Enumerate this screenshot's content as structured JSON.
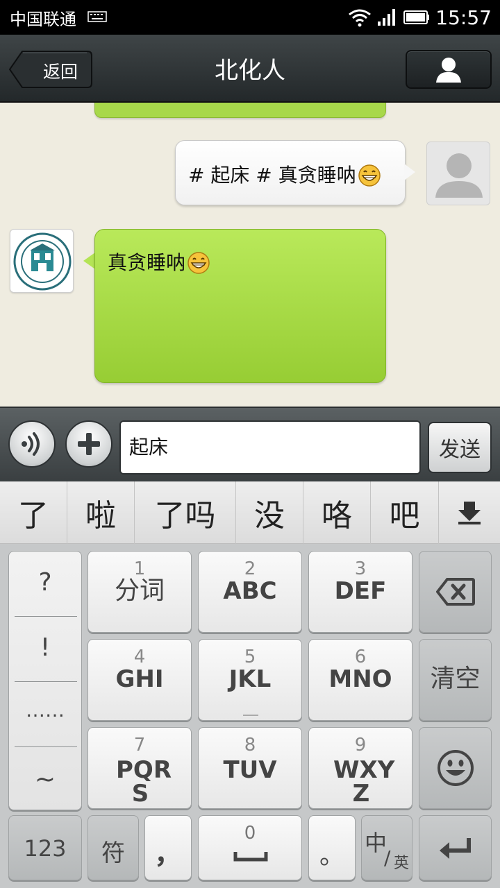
{
  "status_bar": {
    "carrier": "中国联通",
    "time": "15:57"
  },
  "header": {
    "back_label": "返回",
    "title": "北化人"
  },
  "chat": {
    "messages": [
      {
        "direction": "outgoing",
        "text": "# 起床 # 真贪睡呐"
      },
      {
        "direction": "incoming",
        "text": "真贪睡呐"
      }
    ]
  },
  "composer": {
    "input_value": "起床",
    "send_label": "发送"
  },
  "candidates": [
    "了",
    "啦",
    "了吗",
    "没",
    "咯",
    "吧"
  ],
  "keyboard": {
    "symbols": [
      "?",
      "!",
      "……",
      "~"
    ],
    "keys": [
      {
        "num": "1",
        "label": "分词"
      },
      {
        "num": "2",
        "label": "ABC"
      },
      {
        "num": "3",
        "label": "DEF"
      },
      {
        "num": "4",
        "label": "GHI"
      },
      {
        "num": "5",
        "label": "JKL"
      },
      {
        "num": "6",
        "label": "MNO"
      },
      {
        "num": "7",
        "label": "PQR S"
      },
      {
        "num": "8",
        "label": "TUV"
      },
      {
        "num": "9",
        "label": "WXY Z"
      }
    ],
    "clear_label": "清空",
    "num_label": "123",
    "symbol_label": "符",
    "comma": "，",
    "space_num": "0",
    "period": "。",
    "lang_cn": "中",
    "lang_en": "英"
  },
  "colors": {
    "incoming_bubble": "#a8d84a",
    "chat_background": "#efece0",
    "titlebar": "#2b3032"
  }
}
